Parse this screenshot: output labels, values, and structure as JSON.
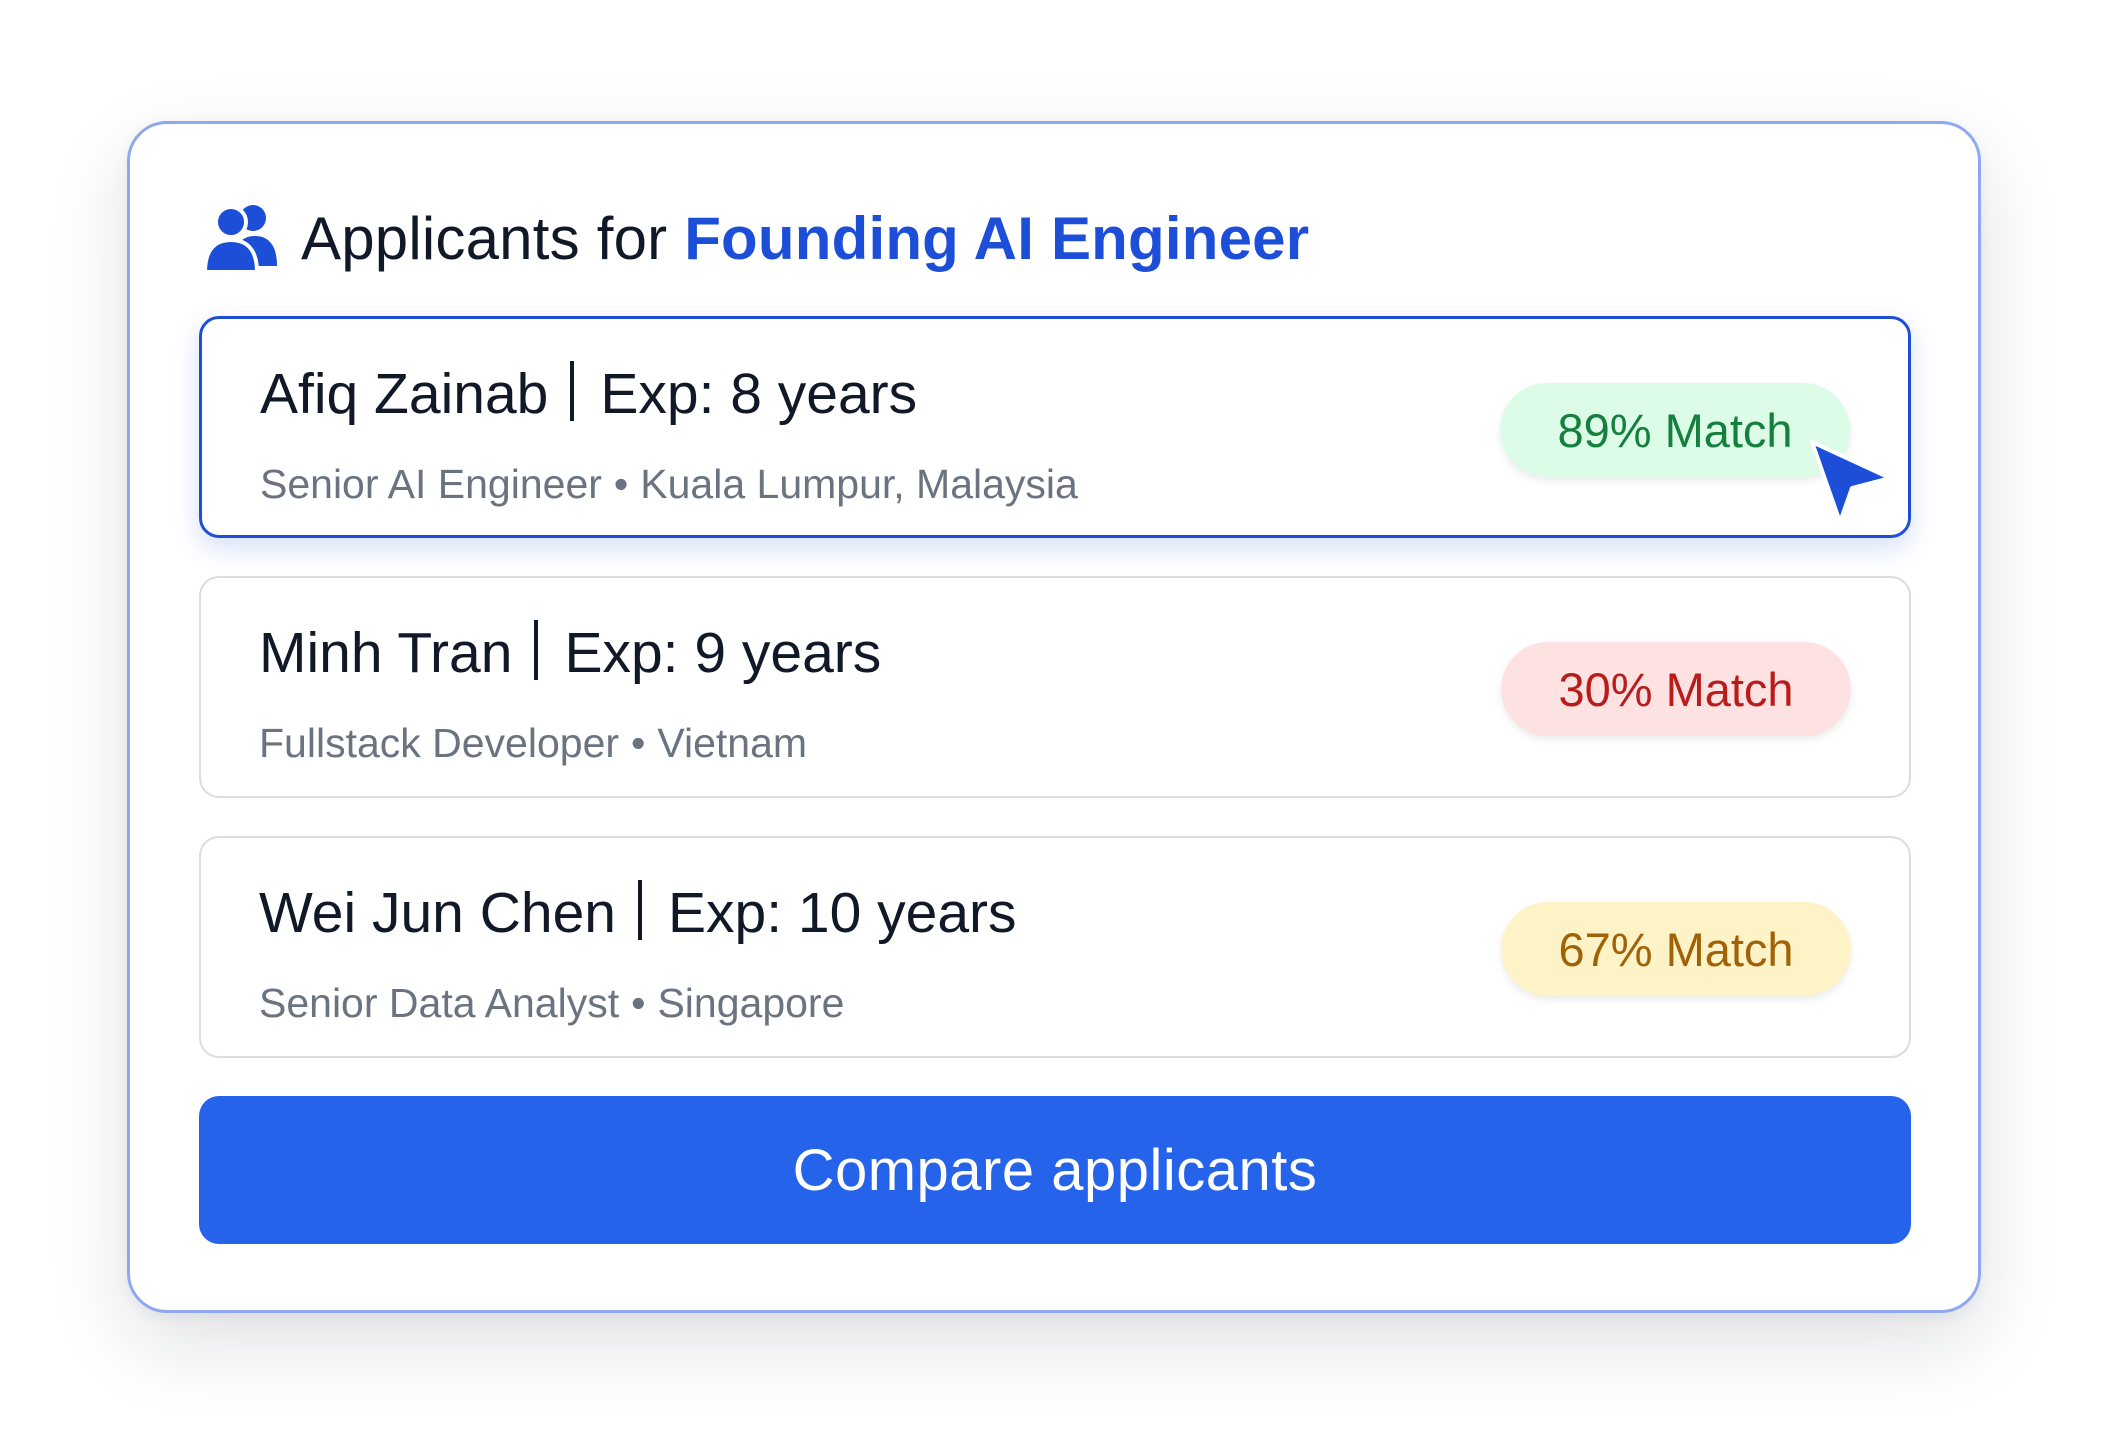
{
  "header": {
    "icon": "users-icon",
    "title_prefix": "Applicants for",
    "role": "Founding AI Engineer"
  },
  "applicants": [
    {
      "name": "Afiq Zainab",
      "experience": "Exp: 8 years",
      "title": "Senior AI Engineer",
      "location": "Kuala Lumpur, Malaysia",
      "match": "89% Match",
      "match_color": "green",
      "selected": true
    },
    {
      "name": "Minh Tran",
      "experience": "Exp: 9 years",
      "title": "Fullstack Developer",
      "location": "Vietnam",
      "match": "30% Match",
      "match_color": "red",
      "selected": false
    },
    {
      "name": "Wei Jun Chen",
      "experience": "Exp: 10 years",
      "title": "Senior Data Analyst",
      "location": "Singapore",
      "match": "67% Match",
      "match_color": "yellow",
      "selected": false
    }
  ],
  "separator_dot": "•",
  "actions": {
    "compare_label": "Compare applicants"
  },
  "colors": {
    "accent": "#2563eb",
    "selected_border": "#1d4ed8",
    "match_green_bg": "#dcfce7",
    "match_red_bg": "#fee2e2",
    "match_yellow_bg": "#fef3c7"
  },
  "cursor_icon": "pointer-cursor-icon"
}
